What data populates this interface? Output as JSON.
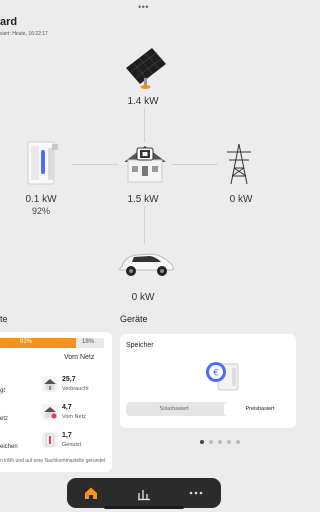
{
  "header": {
    "title": "ard",
    "subtitle": "siert: Heute, 16:22:17",
    "more_dots": "•••"
  },
  "flow": {
    "solar": {
      "value": "1.4 kW",
      "icon": "solar-panel-icon"
    },
    "battery": {
      "value": "0.1 kW",
      "charge": "92%",
      "icon": "battery-storage-icon"
    },
    "house": {
      "value": "1.5 kW",
      "icon": "house-icon"
    },
    "grid": {
      "value": "0 kW",
      "icon": "power-mast-icon"
    },
    "car": {
      "value": "0 kW",
      "icon": "electric-car-icon"
    }
  },
  "energy": {
    "section_title": "te",
    "bar": {
      "self_pct": "82%",
      "grid_pct": "18%",
      "self_fraction": 0.82,
      "grid_label": "Vom Netz"
    },
    "left_items": [
      "gt",
      "etz",
      "eichen"
    ],
    "stats": [
      {
        "value": "25,7",
        "caption": "Verbraucht",
        "icon": "house-consumption-icon"
      },
      {
        "value": "4,7",
        "caption": "Vom Netz",
        "icon": "grid-import-icon"
      },
      {
        "value": "1,7",
        "caption": "Genutzt",
        "icon": "battery-used-icon"
      }
    ],
    "footnote": "n kWh und auf eine Nachkommastelle gerundet"
  },
  "devices": {
    "section_title": "Geräte",
    "card_title": "Speicher",
    "options": [
      "Solarbasiert",
      "Preisbasiert"
    ],
    "selected": "Preisbasiert",
    "pager_count": 5,
    "pager_active": 0
  },
  "tabbar": {
    "tabs": [
      {
        "name": "home",
        "icon": "home-icon",
        "active": true
      },
      {
        "name": "statistics",
        "icon": "chart-icon",
        "active": false
      },
      {
        "name": "more",
        "icon": "more-icon",
        "active": false
      }
    ]
  },
  "colors": {
    "accent": "#f5921e",
    "background": "#ececec",
    "tabbar": "#2b2b2b"
  }
}
